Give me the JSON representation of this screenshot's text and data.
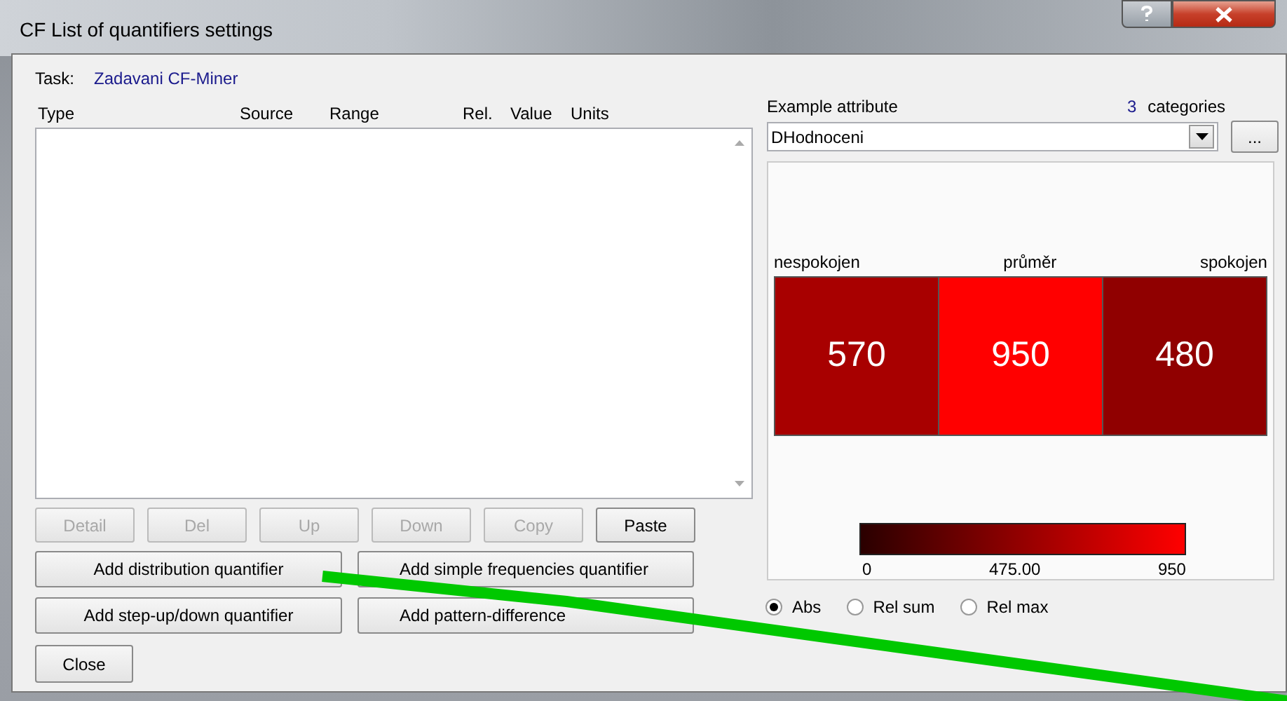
{
  "window": {
    "title": "CF List of quantifiers settings"
  },
  "task": {
    "label": "Task:",
    "value": "Zadavani CF-Miner"
  },
  "table": {
    "columns": [
      "Type",
      "Source",
      "Range",
      "Rel.",
      "Value",
      "Units"
    ]
  },
  "list_buttons": [
    {
      "label": "Detail",
      "disabled": true
    },
    {
      "label": "Del",
      "disabled": true
    },
    {
      "label": "Up",
      "disabled": true
    },
    {
      "label": "Down",
      "disabled": true
    },
    {
      "label": "Copy",
      "disabled": true
    },
    {
      "label": "Paste",
      "disabled": false
    }
  ],
  "add_buttons": [
    "Add distribution quantifier",
    "Add simple frequencies quantifier",
    "Add step-up/down quantifier",
    "Add pattern-difference"
  ],
  "close_button": "Close",
  "attribute": {
    "label": "Example attribute",
    "count": "3",
    "count_label": "categories",
    "value": "DHodnoceni",
    "browse": "..."
  },
  "heatmap": {
    "cells": [
      {
        "category": "nespokojen",
        "value": "570",
        "color": "#a80000"
      },
      {
        "category": "průměr",
        "value": "950",
        "color": "#ff0000"
      },
      {
        "category": "spokojen",
        "value": "480",
        "color": "#900000"
      }
    ],
    "legend": {
      "min": "0",
      "mid": "475.00",
      "max": "950"
    }
  },
  "modes": [
    {
      "label": "Abs",
      "selected": true
    },
    {
      "label": "Rel sum",
      "selected": false
    },
    {
      "label": "Rel max",
      "selected": false
    }
  ]
}
